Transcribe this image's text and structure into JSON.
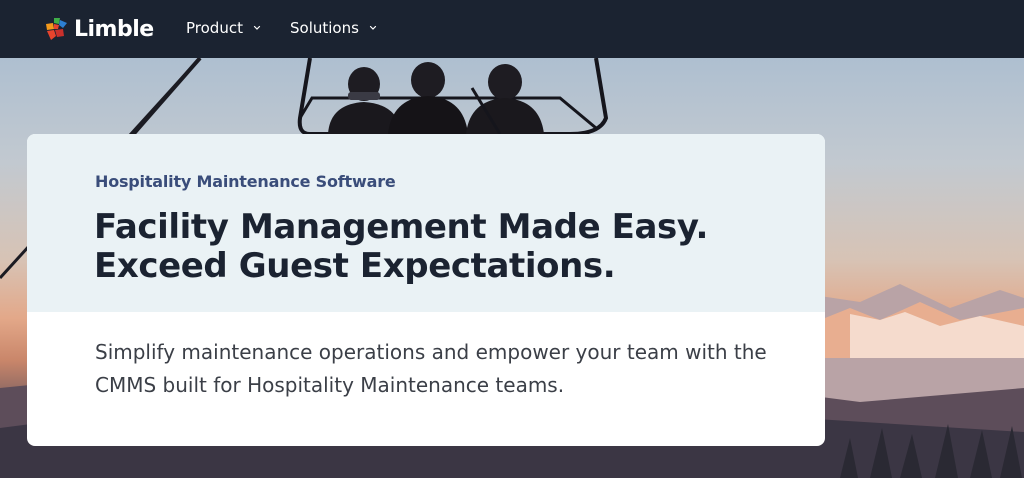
{
  "brand": {
    "name": "Limble",
    "logo_colors": [
      "#e8442d",
      "#f59a1b",
      "#3fae49",
      "#2d7fd1"
    ]
  },
  "nav": {
    "items": [
      {
        "label": "Product",
        "icon": "chevron-down-icon"
      },
      {
        "label": "Solutions",
        "icon": "chevron-down-icon"
      }
    ]
  },
  "hero": {
    "eyebrow": "Hospitality Maintenance Software",
    "headline_line1": "Facility Management Made Easy.",
    "headline_line2": "Exceed Guest Expectations.",
    "subtext": "Simplify maintenance operations and empower your team with the CMMS built for Hospitality Maintenance teams."
  },
  "colors": {
    "nav_bg": "#1b2331",
    "eyebrow": "#3a4d7a",
    "headline": "#1b2331",
    "card_top": "#eaf2f5"
  }
}
